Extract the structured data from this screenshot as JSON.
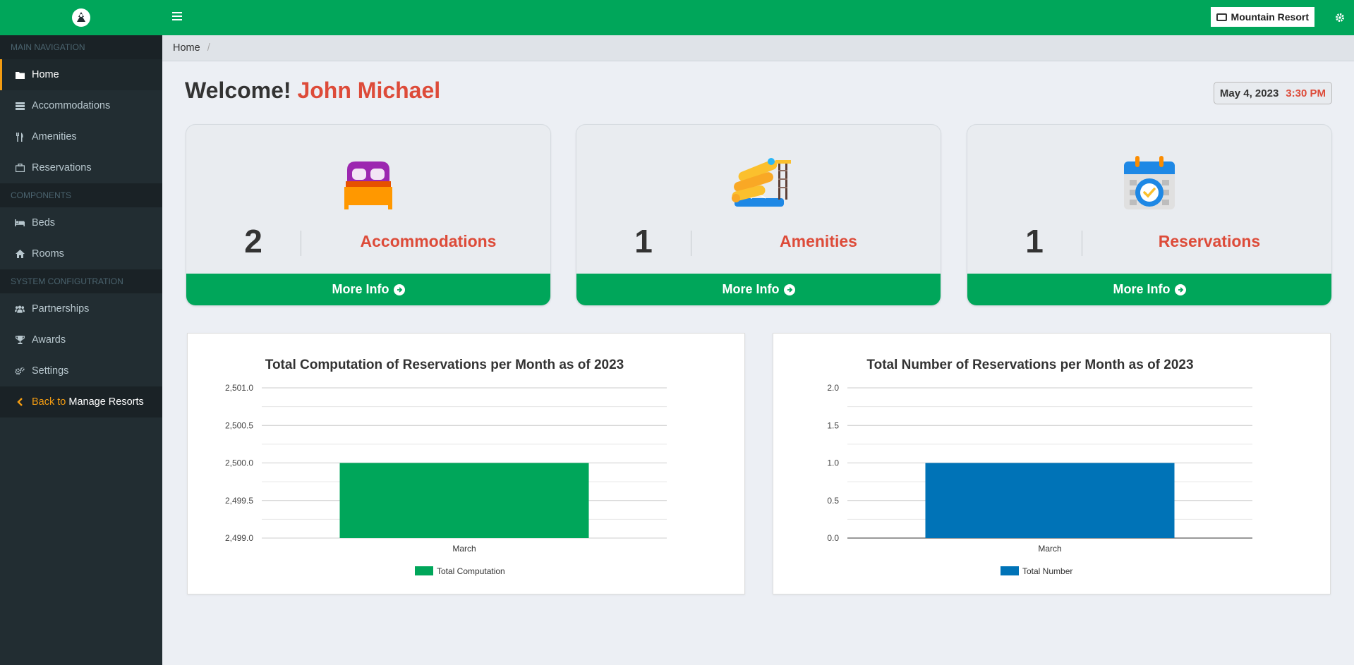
{
  "sidebar": {
    "sections": [
      {
        "header": "MAIN NAVIGATION",
        "items": [
          {
            "label": "Home",
            "icon": "folder-icon"
          },
          {
            "label": "Accommodations",
            "icon": "list-icon"
          },
          {
            "label": "Amenities",
            "icon": "utensils-icon"
          },
          {
            "label": "Reservations",
            "icon": "briefcase-icon"
          }
        ]
      },
      {
        "header": "COMPONENTS",
        "items": [
          {
            "label": "Beds",
            "icon": "bed-icon"
          },
          {
            "label": "Rooms",
            "icon": "home-icon"
          }
        ]
      },
      {
        "header": "SYSTEM CONFIGUTRATION",
        "items": [
          {
            "label": "Partnerships",
            "icon": "users-icon"
          },
          {
            "label": "Awards",
            "icon": "trophy-icon"
          },
          {
            "label": "Settings",
            "icon": "cogs-icon"
          }
        ]
      }
    ],
    "back": {
      "prefix": "Back to",
      "label": "Manage Resorts"
    }
  },
  "topbar": {
    "resort_label": "Mountain Resort"
  },
  "breadcrumb": {
    "home": "Home",
    "separator": "/"
  },
  "welcome": {
    "greeting": "Welcome!",
    "name": "John Michael"
  },
  "datetime": {
    "date": "May 4, 2023",
    "time": "3:30 PM"
  },
  "cards": [
    {
      "count": "2",
      "label": "Accommodations",
      "more": "More Info"
    },
    {
      "count": "1",
      "label": "Amenities",
      "more": "More Info"
    },
    {
      "count": "1",
      "label": "Reservations",
      "more": "More Info"
    }
  ],
  "colors": {
    "brand": "#00a65a",
    "accent": "#dd4b39",
    "sidebar": "#222d32",
    "active_border": "#f39c12",
    "series_blue": "#0073b7"
  },
  "chart_data": [
    {
      "type": "bar",
      "title": "Total Computation of Reservations per Month as of 2023",
      "categories": [
        "March"
      ],
      "series": [
        {
          "name": "Total Computation",
          "values": [
            2500
          ],
          "color": "#00a65a"
        }
      ],
      "ylim": [
        2499.0,
        2501.0
      ],
      "yticks": [
        "2,499.0",
        "2,499.5",
        "2,500.0",
        "2,500.5",
        "2,501.0"
      ],
      "grid": true,
      "legend": "bottom"
    },
    {
      "type": "bar",
      "title": "Total Number of Reservations per Month as of 2023",
      "categories": [
        "March"
      ],
      "series": [
        {
          "name": "Total Number",
          "values": [
            1
          ],
          "color": "#0073b7"
        }
      ],
      "ylim": [
        0,
        2
      ],
      "yticks": [
        "0.0",
        "0.5",
        "1.0",
        "1.5",
        "2.0"
      ],
      "grid": true,
      "legend": "bottom"
    }
  ]
}
